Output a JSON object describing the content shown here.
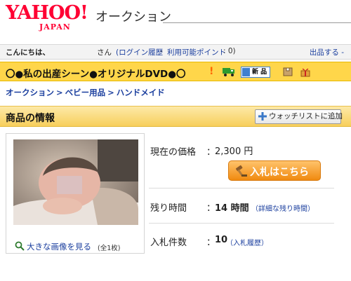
{
  "header": {
    "logo_text": "YAHOO!",
    "logo_sub": "JAPAN",
    "site_name": "オークション"
  },
  "userbar": {
    "greeting": "こんにちは、",
    "san": "さん",
    "login_history": "(ログイン履歴",
    "separator": "-",
    "points_label": "利用可能ポイント",
    "points_value": ": 0)",
    "sell": "出品する -"
  },
  "item": {
    "title": "〇●私の出産シーン●オリジナルDVD●〇",
    "icons": [
      "exclamation-icon",
      "truck-icon",
      "new-badge-icon",
      "box-icon",
      "gift-icon"
    ],
    "new_badge": "新 品"
  },
  "breadcrumb": [
    "オークション",
    "ベビー用品",
    "ハンドメイド"
  ],
  "breadcrumb_sep": ">",
  "section": {
    "title": "商品の情報",
    "watchlist_button": "ウォッチリストに追加"
  },
  "photo": {
    "zoom_link": "大きな画像を見る",
    "count": "(全1枚)"
  },
  "info": {
    "price_label": "現在の価格",
    "price_colon": "：",
    "price_value": "2,300 円",
    "bid_button": "入札はこちら",
    "time_label": "残り時間",
    "time_colon": "：",
    "time_value": "14 時間",
    "time_detail": "（詳細な残り時間）",
    "bids_label": "入札件数",
    "bids_colon": "：",
    "bids_value": "10",
    "bids_history": "（入札履歴）"
  },
  "colors": {
    "accent_yellow": "#ffd64a",
    "link_blue": "#1a3e9e",
    "logo_red": "#ff0033",
    "bid_orange": "#f08a10"
  }
}
